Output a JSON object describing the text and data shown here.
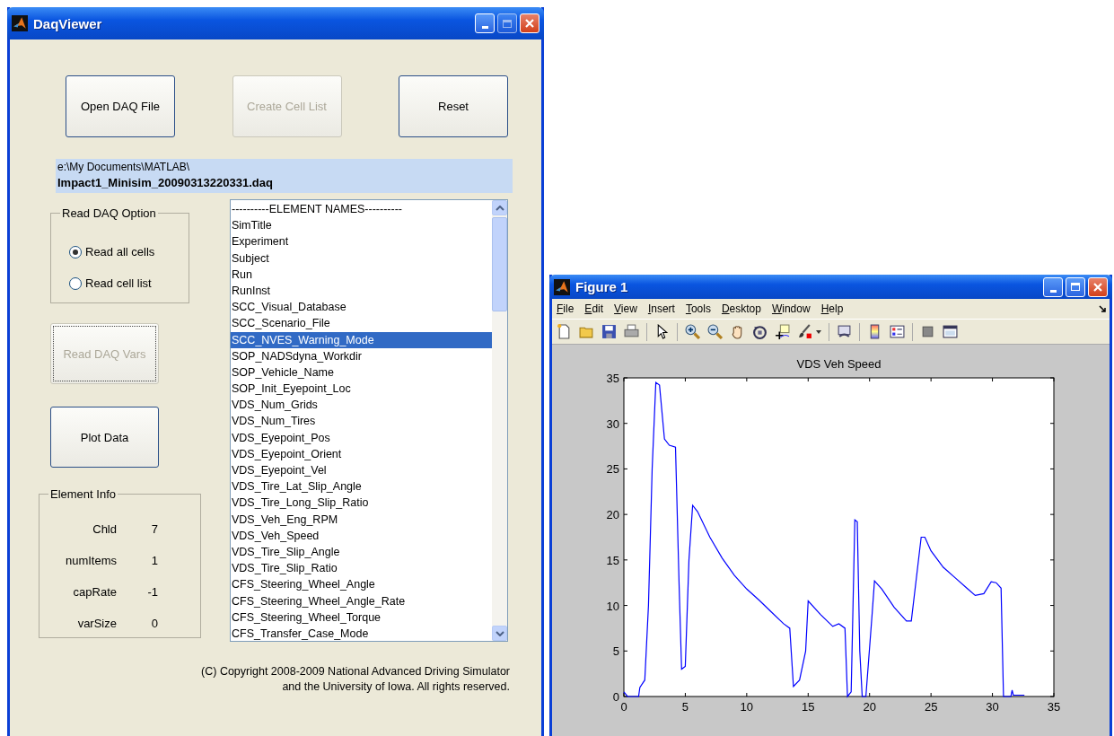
{
  "daq_window": {
    "title": "DaqViewer",
    "buttons": [
      {
        "label": "Open DAQ File",
        "disabled": false
      },
      {
        "label": "Create Cell List",
        "disabled": true
      },
      {
        "label": "Reset",
        "disabled": false
      }
    ],
    "file_path": {
      "directory": "e:\\My Documents\\MATLAB\\",
      "file_name": "Impact1_Minisim_20090313220331.daq"
    },
    "read_option": {
      "title": "Read DAQ Option",
      "options": [
        {
          "label": "Read all cells",
          "selected": true
        },
        {
          "label": "Read cell list",
          "selected": false
        }
      ]
    },
    "read_vars_button": {
      "label": "Read DAQ Vars",
      "disabled": true
    },
    "plot_button": {
      "label": "Plot Data",
      "disabled": false
    },
    "element_info": {
      "title": "Element Info",
      "fields": [
        {
          "label": "Chld",
          "value": "7"
        },
        {
          "label": "numItems",
          "value": "1"
        },
        {
          "label": "capRate",
          "value": "-1"
        },
        {
          "label": "varSize",
          "value": "0"
        }
      ]
    },
    "element_list": {
      "items": [
        {
          "label": "----------ELEMENT NAMES----------",
          "selected": false
        },
        {
          "label": "SimTitle",
          "selected": false
        },
        {
          "label": "Experiment",
          "selected": false
        },
        {
          "label": "Subject",
          "selected": false
        },
        {
          "label": "Run",
          "selected": false
        },
        {
          "label": "RunInst",
          "selected": false
        },
        {
          "label": "SCC_Visual_Database",
          "selected": false
        },
        {
          "label": "SCC_Scenario_File",
          "selected": false
        },
        {
          "label": "SCC_NVES_Warning_Mode",
          "selected": true
        },
        {
          "label": "SOP_NADSdyna_Workdir",
          "selected": false
        },
        {
          "label": "SOP_Vehicle_Name",
          "selected": false
        },
        {
          "label": "SOP_Init_Eyepoint_Loc",
          "selected": false
        },
        {
          "label": "VDS_Num_Grids",
          "selected": false
        },
        {
          "label": "VDS_Num_Tires",
          "selected": false
        },
        {
          "label": "VDS_Eyepoint_Pos",
          "selected": false
        },
        {
          "label": "VDS_Eyepoint_Orient",
          "selected": false
        },
        {
          "label": "VDS_Eyepoint_Vel",
          "selected": false
        },
        {
          "label": "VDS_Tire_Lat_Slip_Angle",
          "selected": false
        },
        {
          "label": "VDS_Tire_Long_Slip_Ratio",
          "selected": false
        },
        {
          "label": "VDS_Veh_Eng_RPM",
          "selected": false
        },
        {
          "label": "VDS_Veh_Speed",
          "selected": false
        },
        {
          "label": "VDS_Tire_Slip_Angle",
          "selected": false
        },
        {
          "label": "VDS_Tire_Slip_Ratio",
          "selected": false
        },
        {
          "label": "CFS_Steering_Wheel_Angle",
          "selected": false
        },
        {
          "label": "CFS_Steering_Wheel_Angle_Rate",
          "selected": false
        },
        {
          "label": "CFS_Steering_Wheel_Torque",
          "selected": false
        },
        {
          "label": "CFS_Transfer_Case_Mode",
          "selected": false
        }
      ]
    },
    "copyright": [
      "(C) Copyright 2008-2009 National Advanced Driving Simulator",
      "and the University of Iowa.  All rights reserved."
    ]
  },
  "figure_window": {
    "title": "Figure 1",
    "menu": [
      "File",
      "Edit",
      "View",
      "Insert",
      "Tools",
      "Desktop",
      "Window",
      "Help"
    ],
    "chart_data": {
      "type": "line",
      "title": "VDS Veh Speed",
      "x": [
        0,
        0.3,
        1.2,
        1.3,
        1.7,
        2.0,
        2.3,
        2.6,
        2.9,
        3.3,
        3.7,
        4.2,
        4.5,
        4.7,
        5.0,
        5.3,
        5.6,
        6.0,
        7,
        8,
        9,
        10,
        11,
        12,
        13,
        13.5,
        13.8,
        14.3,
        14.8,
        15.0,
        16,
        17,
        17.5,
        18,
        18.2,
        18.5,
        18.8,
        19.0,
        19.2,
        19.4,
        19.7,
        20.2,
        20.4,
        21,
        22,
        23,
        23.4,
        24.2,
        24.5,
        25,
        26,
        27,
        28,
        28.6,
        29.3,
        29.9,
        30.3,
        30.7,
        30.9,
        31.5,
        31.6,
        31.7,
        32.6
      ],
      "series": [
        {
          "color": "#0000ff",
          "values": [
            0.5,
            0,
            0,
            1,
            1.8,
            10,
            25,
            34.5,
            34.2,
            28.3,
            27.6,
            27.4,
            12,
            3,
            3.3,
            15,
            21,
            20.3,
            17.5,
            15.2,
            13.3,
            11.8,
            10.6,
            9.3,
            8,
            7.5,
            1.1,
            1.8,
            5,
            10.5,
            9,
            7.7,
            8,
            7.5,
            0,
            0.5,
            19.4,
            19.2,
            5,
            0,
            0,
            9,
            12.7,
            11.8,
            9.8,
            8.3,
            8.3,
            17.5,
            17.5,
            16,
            14.2,
            13,
            11.8,
            11.1,
            11.3,
            12.6,
            12.5,
            11.9,
            0,
            0,
            0.7,
            0.15,
            0.15
          ]
        }
      ],
      "xlim": [
        0,
        35
      ],
      "ylim": [
        0,
        35
      ],
      "xticks": [
        0,
        5,
        10,
        15,
        20,
        25,
        30,
        35
      ],
      "yticks": [
        0,
        5,
        10,
        15,
        20,
        25,
        30,
        35
      ]
    }
  }
}
